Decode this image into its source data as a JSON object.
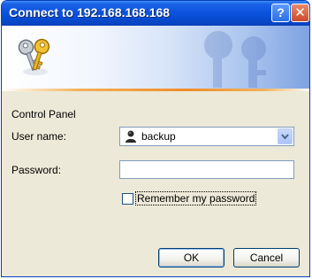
{
  "window": {
    "title": "Connect to 192.168.168.168",
    "help_glyph": "?",
    "close_glyph": "✕"
  },
  "banner": {
    "icon": "keys-icon"
  },
  "form": {
    "realm": "Control Panel",
    "username_label": "User name:",
    "username_value": "backup",
    "password_label": "Password:",
    "password_value": "",
    "remember_label": "Remember my password",
    "remember_checked": false
  },
  "buttons": {
    "ok": "OK",
    "cancel": "Cancel"
  },
  "colors": {
    "titlebar": "#0a52dc",
    "dialog_bg": "#ece9d8",
    "accent_orange": "#f08c28"
  }
}
